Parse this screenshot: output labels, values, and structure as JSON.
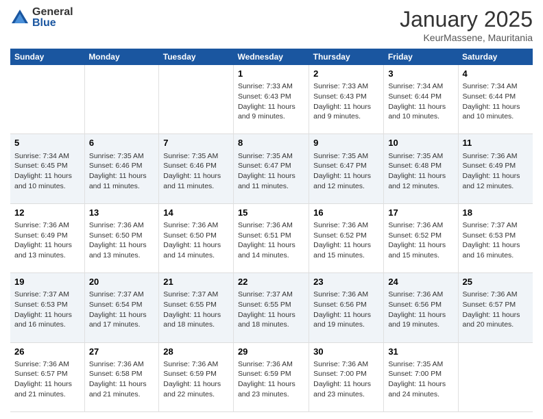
{
  "logo": {
    "general": "General",
    "blue": "Blue"
  },
  "header": {
    "title": "January 2025",
    "subtitle": "KeurMassene, Mauritania"
  },
  "weekdays": [
    "Sunday",
    "Monday",
    "Tuesday",
    "Wednesday",
    "Thursday",
    "Friday",
    "Saturday"
  ],
  "weeks": [
    [
      {
        "day": "",
        "info": ""
      },
      {
        "day": "",
        "info": ""
      },
      {
        "day": "",
        "info": ""
      },
      {
        "day": "1",
        "info": "Sunrise: 7:33 AM\nSunset: 6:43 PM\nDaylight: 11 hours and 9 minutes."
      },
      {
        "day": "2",
        "info": "Sunrise: 7:33 AM\nSunset: 6:43 PM\nDaylight: 11 hours and 9 minutes."
      },
      {
        "day": "3",
        "info": "Sunrise: 7:34 AM\nSunset: 6:44 PM\nDaylight: 11 hours and 10 minutes."
      },
      {
        "day": "4",
        "info": "Sunrise: 7:34 AM\nSunset: 6:44 PM\nDaylight: 11 hours and 10 minutes."
      }
    ],
    [
      {
        "day": "5",
        "info": "Sunrise: 7:34 AM\nSunset: 6:45 PM\nDaylight: 11 hours and 10 minutes."
      },
      {
        "day": "6",
        "info": "Sunrise: 7:35 AM\nSunset: 6:46 PM\nDaylight: 11 hours and 11 minutes."
      },
      {
        "day": "7",
        "info": "Sunrise: 7:35 AM\nSunset: 6:46 PM\nDaylight: 11 hours and 11 minutes."
      },
      {
        "day": "8",
        "info": "Sunrise: 7:35 AM\nSunset: 6:47 PM\nDaylight: 11 hours and 11 minutes."
      },
      {
        "day": "9",
        "info": "Sunrise: 7:35 AM\nSunset: 6:47 PM\nDaylight: 11 hours and 12 minutes."
      },
      {
        "day": "10",
        "info": "Sunrise: 7:35 AM\nSunset: 6:48 PM\nDaylight: 11 hours and 12 minutes."
      },
      {
        "day": "11",
        "info": "Sunrise: 7:36 AM\nSunset: 6:49 PM\nDaylight: 11 hours and 12 minutes."
      }
    ],
    [
      {
        "day": "12",
        "info": "Sunrise: 7:36 AM\nSunset: 6:49 PM\nDaylight: 11 hours and 13 minutes."
      },
      {
        "day": "13",
        "info": "Sunrise: 7:36 AM\nSunset: 6:50 PM\nDaylight: 11 hours and 13 minutes."
      },
      {
        "day": "14",
        "info": "Sunrise: 7:36 AM\nSunset: 6:50 PM\nDaylight: 11 hours and 14 minutes."
      },
      {
        "day": "15",
        "info": "Sunrise: 7:36 AM\nSunset: 6:51 PM\nDaylight: 11 hours and 14 minutes."
      },
      {
        "day": "16",
        "info": "Sunrise: 7:36 AM\nSunset: 6:52 PM\nDaylight: 11 hours and 15 minutes."
      },
      {
        "day": "17",
        "info": "Sunrise: 7:36 AM\nSunset: 6:52 PM\nDaylight: 11 hours and 15 minutes."
      },
      {
        "day": "18",
        "info": "Sunrise: 7:37 AM\nSunset: 6:53 PM\nDaylight: 11 hours and 16 minutes."
      }
    ],
    [
      {
        "day": "19",
        "info": "Sunrise: 7:37 AM\nSunset: 6:53 PM\nDaylight: 11 hours and 16 minutes."
      },
      {
        "day": "20",
        "info": "Sunrise: 7:37 AM\nSunset: 6:54 PM\nDaylight: 11 hours and 17 minutes."
      },
      {
        "day": "21",
        "info": "Sunrise: 7:37 AM\nSunset: 6:55 PM\nDaylight: 11 hours and 18 minutes."
      },
      {
        "day": "22",
        "info": "Sunrise: 7:37 AM\nSunset: 6:55 PM\nDaylight: 11 hours and 18 minutes."
      },
      {
        "day": "23",
        "info": "Sunrise: 7:36 AM\nSunset: 6:56 PM\nDaylight: 11 hours and 19 minutes."
      },
      {
        "day": "24",
        "info": "Sunrise: 7:36 AM\nSunset: 6:56 PM\nDaylight: 11 hours and 19 minutes."
      },
      {
        "day": "25",
        "info": "Sunrise: 7:36 AM\nSunset: 6:57 PM\nDaylight: 11 hours and 20 minutes."
      }
    ],
    [
      {
        "day": "26",
        "info": "Sunrise: 7:36 AM\nSunset: 6:57 PM\nDaylight: 11 hours and 21 minutes."
      },
      {
        "day": "27",
        "info": "Sunrise: 7:36 AM\nSunset: 6:58 PM\nDaylight: 11 hours and 21 minutes."
      },
      {
        "day": "28",
        "info": "Sunrise: 7:36 AM\nSunset: 6:59 PM\nDaylight: 11 hours and 22 minutes."
      },
      {
        "day": "29",
        "info": "Sunrise: 7:36 AM\nSunset: 6:59 PM\nDaylight: 11 hours and 23 minutes."
      },
      {
        "day": "30",
        "info": "Sunrise: 7:36 AM\nSunset: 7:00 PM\nDaylight: 11 hours and 23 minutes."
      },
      {
        "day": "31",
        "info": "Sunrise: 7:35 AM\nSunset: 7:00 PM\nDaylight: 11 hours and 24 minutes."
      },
      {
        "day": "",
        "info": ""
      }
    ]
  ]
}
